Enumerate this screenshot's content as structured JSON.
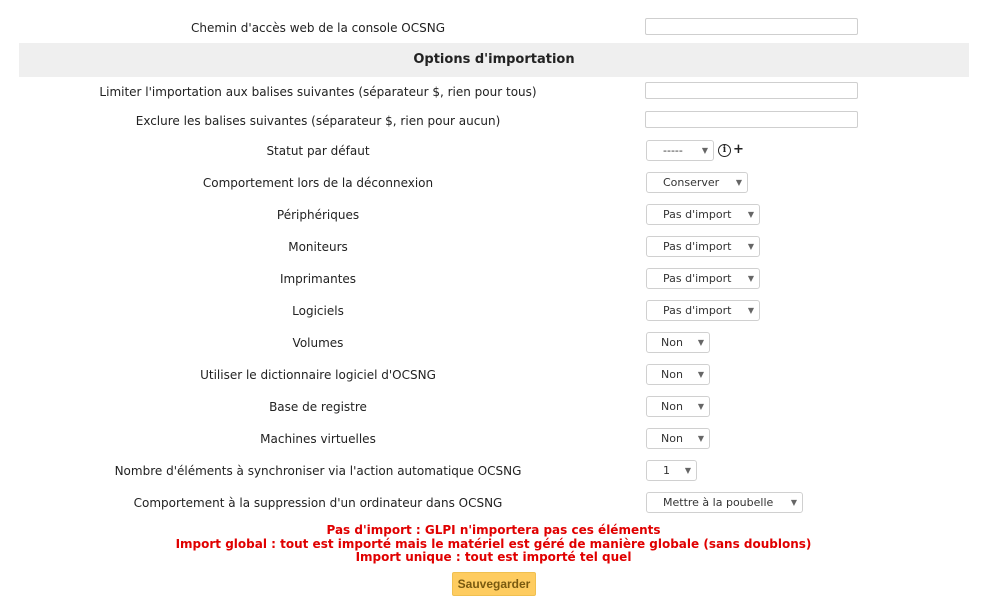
{
  "web_path": {
    "label": "Chemin d'accès web de la console OCSNG",
    "value": ""
  },
  "section": {
    "title": "Options d'importation"
  },
  "fields": {
    "limit_tags": {
      "label": "Limiter l'importation aux balises suivantes (séparateur $, rien pour tous)",
      "value": ""
    },
    "exclude_tags": {
      "label": "Exclure les balises suivantes (séparateur $, rien pour aucun)",
      "value": ""
    },
    "default_status": {
      "label": "Statut par défaut",
      "value": "-----"
    },
    "disconnect_behavior": {
      "label": "Comportement lors de la déconnexion",
      "value": "Conserver"
    },
    "peripherals": {
      "label": "Périphériques",
      "value": "Pas d'import"
    },
    "monitors": {
      "label": "Moniteurs",
      "value": "Pas d'import"
    },
    "printers": {
      "label": "Imprimantes",
      "value": "Pas d'import"
    },
    "software": {
      "label": "Logiciels",
      "value": "Pas d'import"
    },
    "volumes": {
      "label": "Volumes",
      "value": "Non"
    },
    "software_dictionary": {
      "label": "Utiliser le dictionnaire logiciel d'OCSNG",
      "value": "Non"
    },
    "registry": {
      "label": "Base de registre",
      "value": "Non"
    },
    "virtual_machines": {
      "label": "Machines virtuelles",
      "value": "Non"
    },
    "sync_count": {
      "label": "Nombre d'éléments à synchroniser via l'action automatique OCSNG",
      "value": "1"
    },
    "delete_behavior": {
      "label": "Comportement à la suppression d'un ordinateur dans OCSNG",
      "value": "Mettre à la poubelle"
    }
  },
  "icons": {
    "info": "info-icon",
    "add": "plus-icon",
    "dropdown": "chevron-down-icon"
  },
  "notes": [
    "Pas d'import : GLPI n'importera pas ces éléments",
    "Import global : tout est importé mais le matériel est géré de manière globale (sans doublons)",
    "Import unique : tout est importé tel quel"
  ],
  "buttons": {
    "save": "Sauvegarder"
  },
  "colors": {
    "note_text": "#e00000",
    "save_button": "#fecc60",
    "section_bg": "#efefef"
  }
}
